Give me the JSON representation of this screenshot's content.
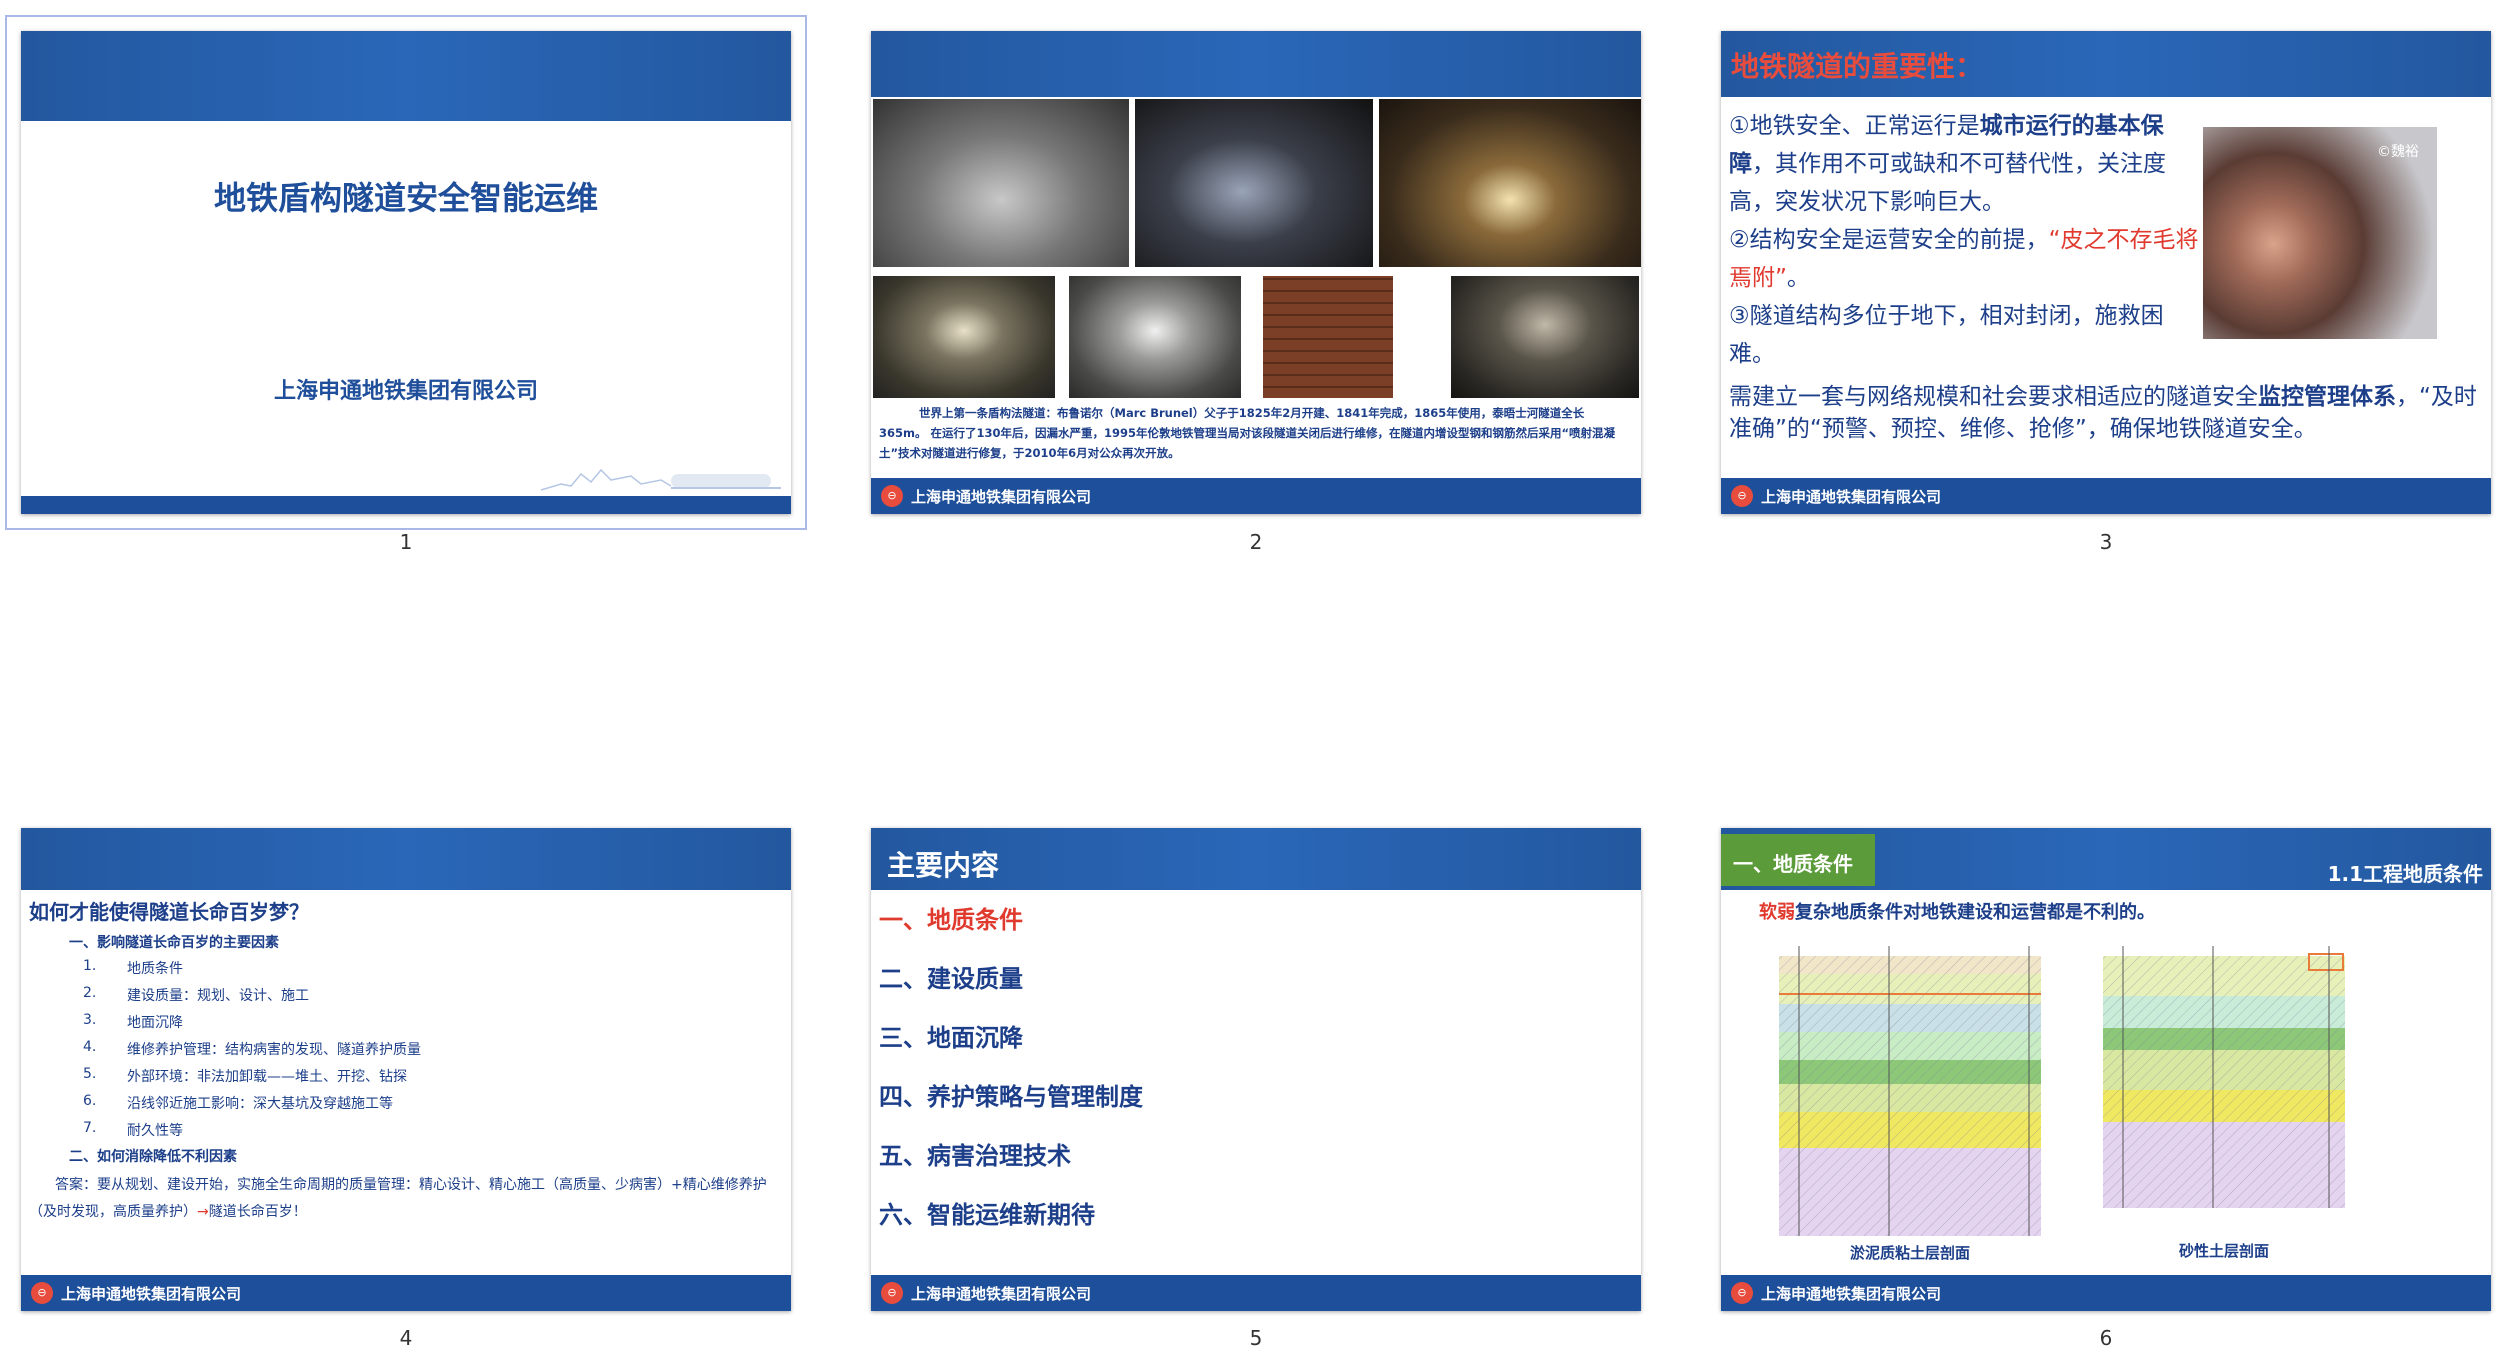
{
  "slides": [
    {
      "number": "1",
      "title": "地铁盾构隧道安全智能运维",
      "company": "上海申通地铁集团有限公司"
    },
    {
      "number": "2",
      "caption": "世界上第一条盾构法隧道：布鲁诺尔（Marc Brunel）父子于1825年2月开建、1841年完成，1865年使用，泰晤士河隧道全长365m。 在运行了130年后，因漏水严重，1995年伦敦地铁管理当局对该段隧道关闭后进行维修，在隧道内增设型钢和钢筋然后采用“喷射混凝土”技术对隧道进行修复，于2010年6月对公众再次开放。",
      "footer": "上海申通地铁集团有限公司"
    },
    {
      "number": "3",
      "heading": "地铁隧道的重要性：",
      "p1a": "①地铁安全、正常运行是",
      "p1b": "城市运行的基本保障",
      "p1c": "，其作用不可或缺和不可替代性，关注度高，突发状况下影响巨大。",
      "p2a": "②结构安全是运营安全的前提，",
      "p2b": "“皮之不存毛将焉附”",
      "p2c": "。",
      "p3": "③隧道结构多位于地下，相对封闭，施救困难。",
      "p4a": "需建立一套与网络规模和社会要求相适应的隧道安全",
      "p4b": "监控管理体系",
      "p4c": "，“及时准确”的“预警、预控、维修、抢修”，确保地铁隧道安全。",
      "watermark": "©魏裕",
      "footer": "上海申通地铁集团有限公司"
    },
    {
      "number": "4",
      "question": "如何才能使得隧道长命百岁梦？",
      "sec1": "一、影响隧道长命百岁的主要因素",
      "items": [
        {
          "n": "1.",
          "t": "地质条件"
        },
        {
          "n": "2.",
          "t": "建设质量：规划、设计、施工"
        },
        {
          "n": "3.",
          "t": "地面沉降"
        },
        {
          "n": "4.",
          "t": "维修养护管理：结构病害的发现、隧道养护质量"
        },
        {
          "n": "5.",
          "t": "外部环境：非法加卸载——堆土、开挖、钻探"
        },
        {
          "n": "6.",
          "t": "沿线邻近施工影响：深大基坑及穿越施工等"
        },
        {
          "n": "7.",
          "t": "耐久性等"
        }
      ],
      "sec2": "二、如何消除降低不利因素",
      "answer_a": "答案：要从规划、建设开始，实施全生命周期的质量管理：精心设计、精心施工（高质量、少病害）+精心维修养护（及时发现，高质量养护）",
      "answer_arrow": "→",
      "answer_b": "隧道长命百岁！",
      "footer": "上海申通地铁集团有限公司"
    },
    {
      "number": "5",
      "header": "主要内容",
      "items": [
        "一、地质条件",
        "二、建设质量",
        "三、地面沉降",
        "四、养护策略与管理制度",
        "五、病害治理技术",
        "六、智能运维新期待"
      ],
      "footer": "上海申通地铁集团有限公司"
    },
    {
      "number": "6",
      "tab": "一、地质条件",
      "subtitle": "1.1工程地质条件",
      "lead_red": "软弱",
      "lead_rest": "复杂地质条件对地铁建设和运营都是不利的。",
      "left_label": "淤泥质粘土层剖面",
      "right_label": "砂性土层剖面",
      "footer": "上海申通地铁集团有限公司"
    }
  ],
  "colors": {
    "header_blue": "#2a67b8",
    "footer_blue": "#1e4f9a",
    "text_blue": "#1d3f8a",
    "accent_red": "#e03a2e",
    "tab_green": "#5c9b3a"
  },
  "icons": {
    "logo": "metro-logo-icon",
    "skyline": "city-skyline-icon"
  }
}
